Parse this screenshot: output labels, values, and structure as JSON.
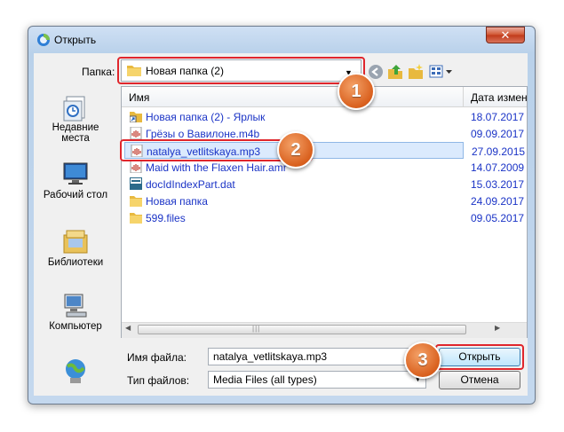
{
  "window": {
    "title": "Открыть",
    "close_symbol": "✕"
  },
  "toolbar": {
    "folder_label": "Папка:",
    "folder_value": "Новая папка (2)",
    "icons": [
      "back-icon",
      "up-folder-icon",
      "new-folder-icon",
      "view-menu-icon"
    ]
  },
  "places": [
    {
      "label": "Недавние места",
      "icon": "recent-places-icon"
    },
    {
      "label": "Рабочий стол",
      "icon": "desktop-icon"
    },
    {
      "label": "Библиотеки",
      "icon": "libraries-icon"
    },
    {
      "label": "Компьютер",
      "icon": "computer-icon"
    }
  ],
  "file_list": {
    "columns": [
      "Имя",
      "Дата измен"
    ],
    "rows": [
      {
        "name": "Новая папка (2) - Ярлык",
        "date": "18.07.2017 ...",
        "icon": "shortcut-icon"
      },
      {
        "name": "Грёзы о Вавилоне.m4b",
        "date": "09.09.2017 ...",
        "icon": "audio-icon"
      },
      {
        "name": "natalya_vetlitskaya.mp3",
        "date": "27.09.2015 ...",
        "icon": "audio-icon",
        "selected": true
      },
      {
        "name": "Maid with the Flaxen Hair.amr",
        "date": "14.07.2009 ...",
        "icon": "audio-icon"
      },
      {
        "name": "docIdIndexPart.dat",
        "date": "15.03.2017 ...",
        "icon": "dat-file-icon"
      },
      {
        "name": "Новая папка",
        "date": "24.09.2017 ...",
        "icon": "folder-icon"
      },
      {
        "name": "599.files",
        "date": "09.05.2017 ...",
        "icon": "folder-icon"
      }
    ]
  },
  "filename": {
    "label": "Имя файла:",
    "value": "natalya_vetlitskaya.mp3"
  },
  "filetype": {
    "label": "Тип файлов:",
    "value": "Media Files (all types)"
  },
  "buttons": {
    "open": "Открыть",
    "cancel": "Отмена"
  },
  "callouts": [
    "1",
    "2",
    "3"
  ],
  "colors": {
    "callout": "#d9601e",
    "highlight": "#e0262c",
    "link": "#1a33c6"
  }
}
